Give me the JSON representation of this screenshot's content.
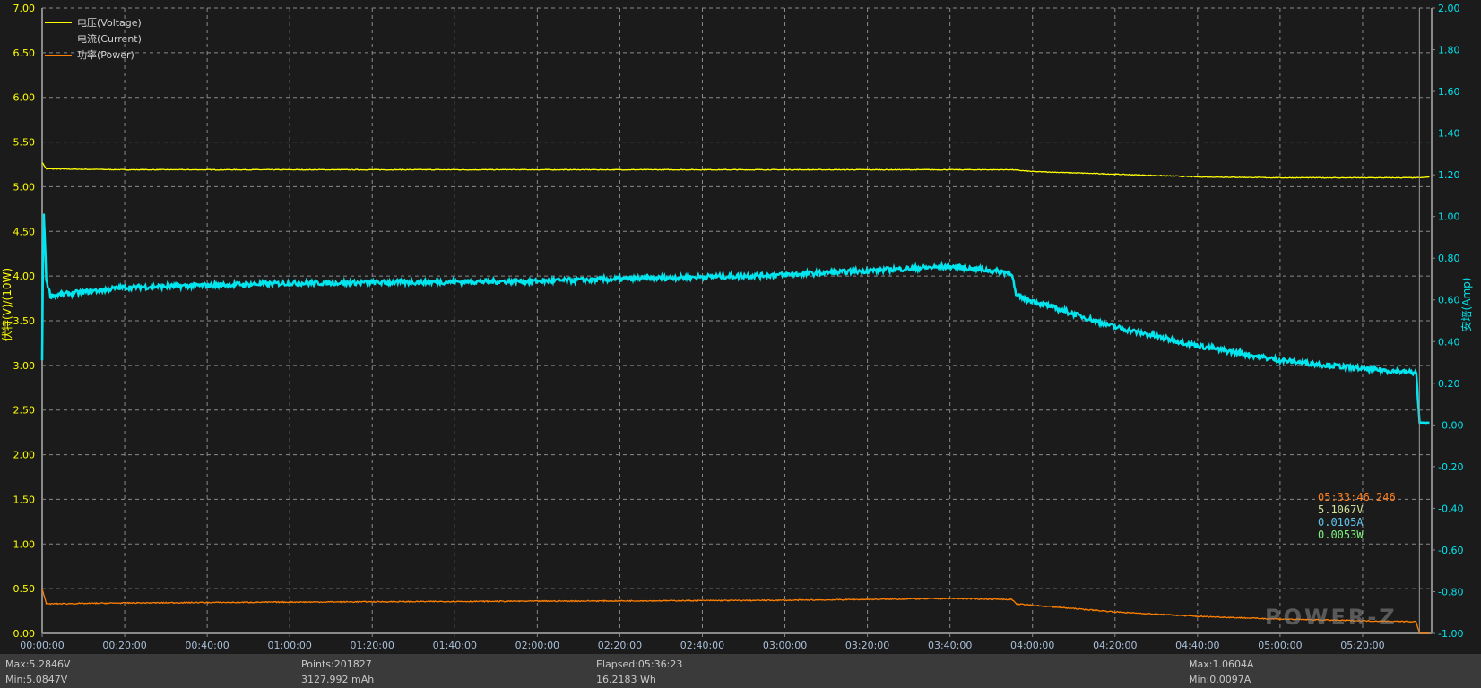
{
  "chart_data": {
    "type": "line",
    "title": "",
    "xlabel": "",
    "ylabel_left": "伏特(V)/(10W)",
    "ylabel_right": "安培(Amp)",
    "ylim_left": [
      0,
      7
    ],
    "ylim_right": [
      -1,
      2
    ],
    "left_ticks": [
      "0.00",
      "0.50",
      "1.00",
      "1.50",
      "2.00",
      "2.50",
      "3.00",
      "3.50",
      "4.00",
      "4.50",
      "5.00",
      "5.50",
      "6.00",
      "6.50",
      "7.00"
    ],
    "right_ticks": [
      "-1.00",
      "-0.80",
      "-0.60",
      "-0.40",
      "-0.20",
      "-0.00",
      "0.20",
      "0.40",
      "0.60",
      "0.80",
      "1.00",
      "1.20",
      "1.40",
      "1.60",
      "1.80",
      "2.00"
    ],
    "x_ticks": [
      "00:00:00",
      "00:20:00",
      "00:40:00",
      "01:00:00",
      "01:20:00",
      "01:40:00",
      "02:00:00",
      "02:20:00",
      "02:40:00",
      "03:00:00",
      "03:20:00",
      "03:40:00",
      "04:00:00",
      "04:20:00",
      "04:40:00",
      "05:00:00",
      "05:20:00"
    ],
    "grid": true,
    "legend_position": "top-left",
    "series": [
      {
        "name": "电压(Voltage)",
        "axis": "left",
        "color": "#ffff00",
        "x": [
          "00:00:00",
          "00:00:20",
          "00:01:00",
          "00:20:00",
          "01:00:00",
          "02:00:00",
          "03:00:00",
          "03:55:00",
          "04:00:00",
          "04:20:00",
          "04:40:00",
          "05:00:00",
          "05:33:46",
          "05:36:23"
        ],
        "values": [
          5.27,
          5.25,
          5.2,
          5.19,
          5.19,
          5.19,
          5.19,
          5.19,
          5.17,
          5.14,
          5.11,
          5.1,
          5.1,
          5.11
        ]
      },
      {
        "name": "电流(Current)",
        "axis": "right",
        "color": "#00e5ee",
        "x": [
          "00:00:00",
          "00:00:20",
          "00:01:00",
          "00:02:00",
          "00:20:00",
          "01:00:00",
          "02:00:00",
          "03:00:00",
          "03:40:00",
          "03:55:00",
          "03:56:00",
          "04:20:00",
          "04:40:00",
          "05:00:00",
          "05:20:00",
          "05:33:00",
          "05:33:46",
          "05:36:23"
        ],
        "values": [
          0.3,
          1.06,
          0.7,
          0.62,
          0.66,
          0.68,
          0.69,
          0.72,
          0.76,
          0.73,
          0.62,
          0.47,
          0.38,
          0.31,
          0.27,
          0.25,
          0.0105,
          0.0105
        ]
      },
      {
        "name": "功率(Power)",
        "axis": "left",
        "unit": "10W",
        "color": "#ff8000",
        "x": [
          "00:00:00",
          "00:00:20",
          "00:01:00",
          "00:20:00",
          "01:00:00",
          "02:00:00",
          "03:00:00",
          "03:40:00",
          "03:55:00",
          "03:56:00",
          "04:20:00",
          "04:40:00",
          "05:00:00",
          "05:20:00",
          "05:33:00",
          "05:33:46",
          "05:36:23"
        ],
        "values": [
          0.5,
          0.45,
          0.33,
          0.34,
          0.35,
          0.36,
          0.37,
          0.39,
          0.38,
          0.33,
          0.24,
          0.19,
          0.16,
          0.14,
          0.13,
          0.0005,
          0.0005
        ]
      }
    ]
  },
  "readout": {
    "time": "05:33:46.246",
    "voltage": "5.1067V",
    "current": "0.0105A",
    "power": "0.0053W"
  },
  "stats": {
    "vmax": "Max:5.2846V",
    "vmin": "Min:5.0847V",
    "points": "Points:201827",
    "capacity": "3127.992 mAh",
    "elapsed": "Elapsed:05:36:23",
    "energy": "16.2183 Wh",
    "amax": "Max:1.0604A",
    "amin": "Min:0.0097A"
  },
  "watermark": "POWER-Z",
  "colors": {
    "background": "#1b1b1b",
    "grid": "#9a9a9a",
    "left_axis_text": "#ffff00",
    "right_axis_text": "#00e5ee",
    "x_axis_text": "#a0b8d8"
  }
}
